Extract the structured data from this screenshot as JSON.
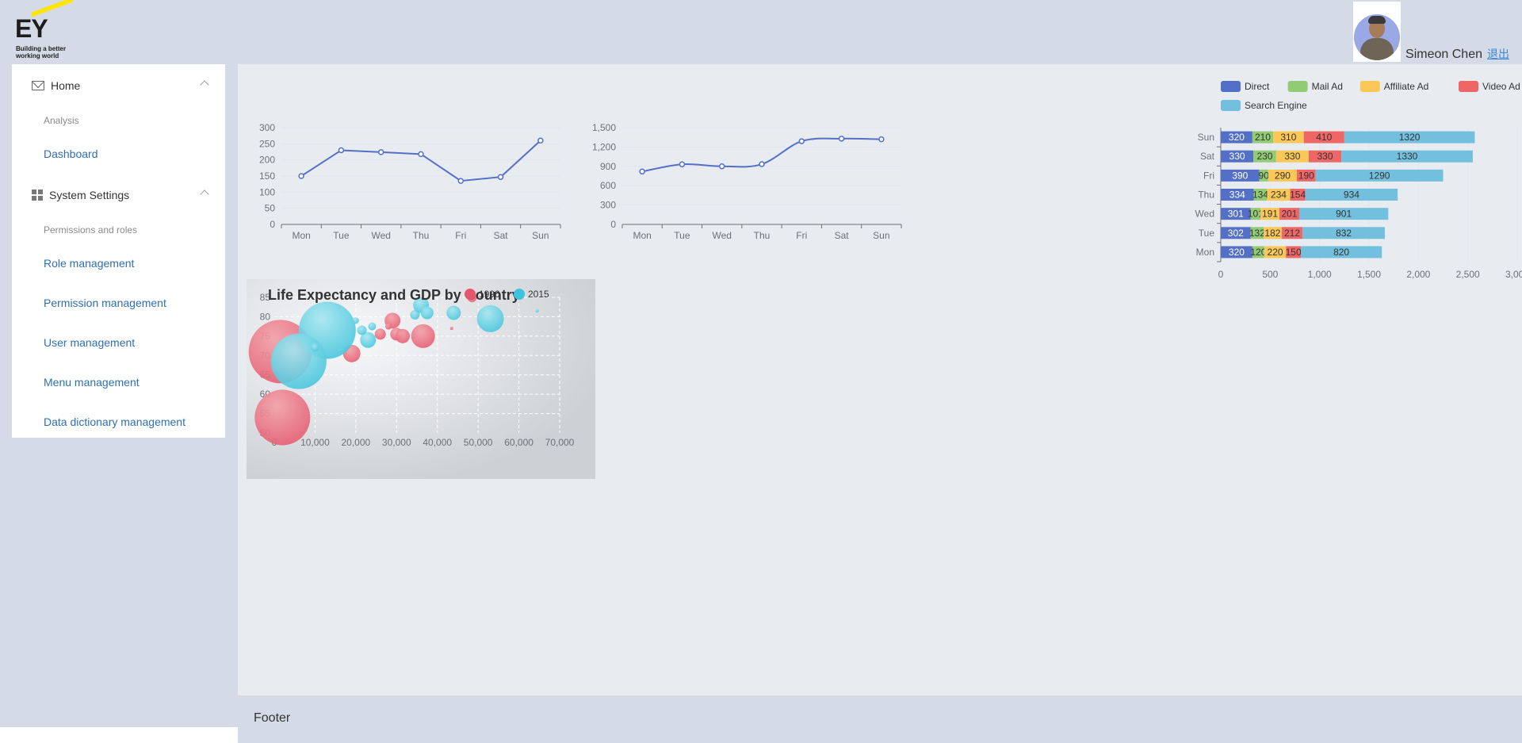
{
  "header": {
    "logo_text": "EY",
    "logo_tagline_1": "Building a better",
    "logo_tagline_2": "working world",
    "user_name": "Simeon Chen",
    "logout_label": "退出"
  },
  "sidebar": {
    "groups": [
      {
        "label": "Home",
        "icon": "mail-icon",
        "sections": [
          {
            "title": "Analysis",
            "items": [
              "Dashboard"
            ]
          }
        ]
      },
      {
        "label": "System Settings",
        "icon": "grid-icon",
        "sections": [
          {
            "title": "Permissions and roles",
            "items": [
              "Role management",
              "Permission management",
              "User management",
              "Menu management",
              "Data dictionary management"
            ]
          }
        ]
      }
    ]
  },
  "footer": {
    "text": "Footer"
  },
  "colors": {
    "blue": "#5470c6",
    "green": "#91cc75",
    "yellow": "#fac858",
    "red": "#ee6666",
    "cyan": "#73c0de",
    "bubble_red": "#e5576c",
    "bubble_cyan": "#3fc3da"
  },
  "chart_data": [
    {
      "type": "line",
      "categories": [
        "Mon",
        "Tue",
        "Wed",
        "Thu",
        "Fri",
        "Sat",
        "Sun"
      ],
      "values": [
        150,
        230,
        224,
        218,
        135,
        147,
        260
      ],
      "ylim": [
        0,
        300
      ],
      "yticks": [
        0,
        50,
        100,
        150,
        200,
        250,
        300
      ],
      "smooth": false
    },
    {
      "type": "line",
      "categories": [
        "Mon",
        "Tue",
        "Wed",
        "Thu",
        "Fri",
        "Sat",
        "Sun"
      ],
      "values": [
        820,
        932,
        901,
        934,
        1290,
        1330,
        1320
      ],
      "ylim": [
        0,
        1500
      ],
      "yticks": [
        "0",
        "300",
        "600",
        "900",
        "1,200",
        "1,500"
      ],
      "smooth": true
    },
    {
      "type": "bar",
      "orientation": "horizontal",
      "stacked": true,
      "categories": [
        "Mon",
        "Tue",
        "Wed",
        "Thu",
        "Fri",
        "Sat",
        "Sun"
      ],
      "series": [
        {
          "name": "Direct",
          "color": "#5470c6",
          "values": [
            320,
            302,
            301,
            334,
            390,
            330,
            320
          ]
        },
        {
          "name": "Mail Ad",
          "color": "#91cc75",
          "values": [
            120,
            132,
            101,
            134,
            90,
            230,
            210
          ]
        },
        {
          "name": "Affiliate Ad",
          "color": "#fac858",
          "values": [
            220,
            182,
            191,
            234,
            290,
            330,
            310
          ]
        },
        {
          "name": "Video Ad",
          "color": "#ee6666",
          "values": [
            150,
            212,
            201,
            154,
            190,
            330,
            410
          ]
        },
        {
          "name": "Search Engine",
          "color": "#73c0de",
          "values": [
            820,
            832,
            901,
            934,
            1290,
            1330,
            1320
          ]
        }
      ],
      "xlim": [
        0,
        3000
      ],
      "xticks": [
        "0",
        "500",
        "1,000",
        "1,500",
        "2,000",
        "2,500",
        "3,000"
      ],
      "legend": "top-left"
    },
    {
      "type": "scatter",
      "title": "Life Expectancy and GDP by Country",
      "legend": [
        "1990",
        "2015"
      ],
      "xlim": [
        0,
        70000
      ],
      "ylim": [
        50,
        85
      ],
      "xticks": [
        "0",
        "10,000",
        "20,000",
        "30,000",
        "40,000",
        "50,000",
        "60,000",
        "70,000"
      ],
      "yticks": [
        "50",
        "55",
        "60",
        "65",
        "70",
        "75",
        "80",
        "85"
      ],
      "series": [
        {
          "name": "1990",
          "color": "#e5576c",
          "points": [
            {
              "x": 1500,
              "y": 71.0,
              "size": 80
            },
            {
              "x": 2000,
              "y": 54.0,
              "size": 70
            },
            {
              "x": 19000,
              "y": 70.5,
              "size": 22
            },
            {
              "x": 26000,
              "y": 75.5,
              "size": 14
            },
            {
              "x": 29000,
              "y": 79.0,
              "size": 20
            },
            {
              "x": 30000,
              "y": 75.5,
              "size": 16
            },
            {
              "x": 31500,
              "y": 75.0,
              "size": 18
            },
            {
              "x": 36500,
              "y": 75.0,
              "size": 30
            },
            {
              "x": 48500,
              "y": 85.0,
              "size": 12
            },
            {
              "x": 43500,
              "y": 77.0,
              "size": 4
            },
            {
              "x": 28000,
              "y": 77.5,
              "size": 8
            }
          ]
        },
        {
          "name": "2015",
          "color": "#3fc3da",
          "points": [
            {
              "x": 13000,
              "y": 76.5,
              "size": 72
            },
            {
              "x": 6000,
              "y": 68.5,
              "size": 70
            },
            {
              "x": 23000,
              "y": 74.0,
              "size": 20
            },
            {
              "x": 24000,
              "y": 77.5,
              "size": 10
            },
            {
              "x": 21500,
              "y": 76.5,
              "size": 12
            },
            {
              "x": 34500,
              "y": 80.5,
              "size": 12
            },
            {
              "x": 36000,
              "y": 83.0,
              "size": 20
            },
            {
              "x": 37500,
              "y": 81.0,
              "size": 16
            },
            {
              "x": 44000,
              "y": 81.0,
              "size": 18
            },
            {
              "x": 53000,
              "y": 79.5,
              "size": 34
            },
            {
              "x": 64500,
              "y": 81.5,
              "size": 4
            },
            {
              "x": 20000,
              "y": 79.0,
              "size": 8
            },
            {
              "x": 10000,
              "y": 72.0,
              "size": 10
            }
          ]
        }
      ]
    }
  ]
}
